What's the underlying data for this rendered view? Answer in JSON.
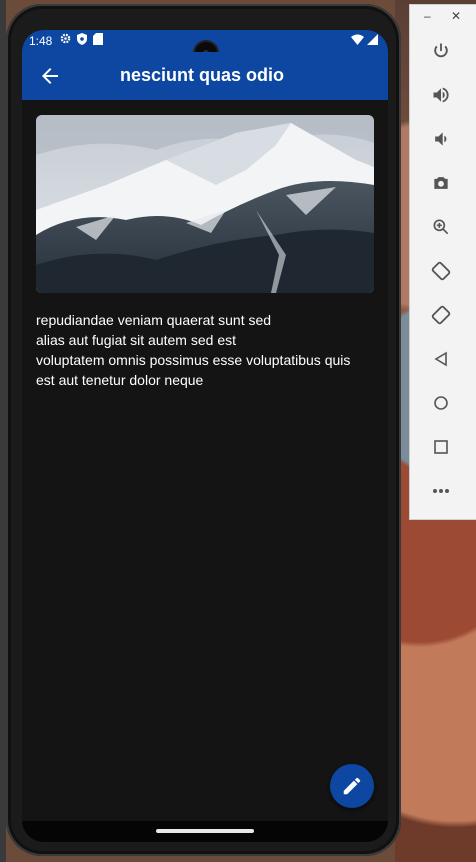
{
  "status_bar": {
    "time": "1:48"
  },
  "app_bar": {
    "title": "nesciunt quas odio"
  },
  "body": {
    "lines": [
      "repudiandae veniam quaerat sunt sed",
      "alias aut fugiat sit autem sed est",
      "voluptatem omnis possimus esse voluptatibus quis",
      "est aut tenetur dolor neque"
    ]
  },
  "icons": {
    "back": "arrow-back-icon",
    "fab": "edit-pencil-icon"
  },
  "colors": {
    "primary": "#0d47a1",
    "background": "#141414",
    "text": "#ffffff"
  },
  "emulator_controls": [
    "power",
    "volume-up",
    "volume-down",
    "screenshot",
    "zoom",
    "rotate-left",
    "rotate-right",
    "back",
    "home",
    "overview",
    "more"
  ]
}
